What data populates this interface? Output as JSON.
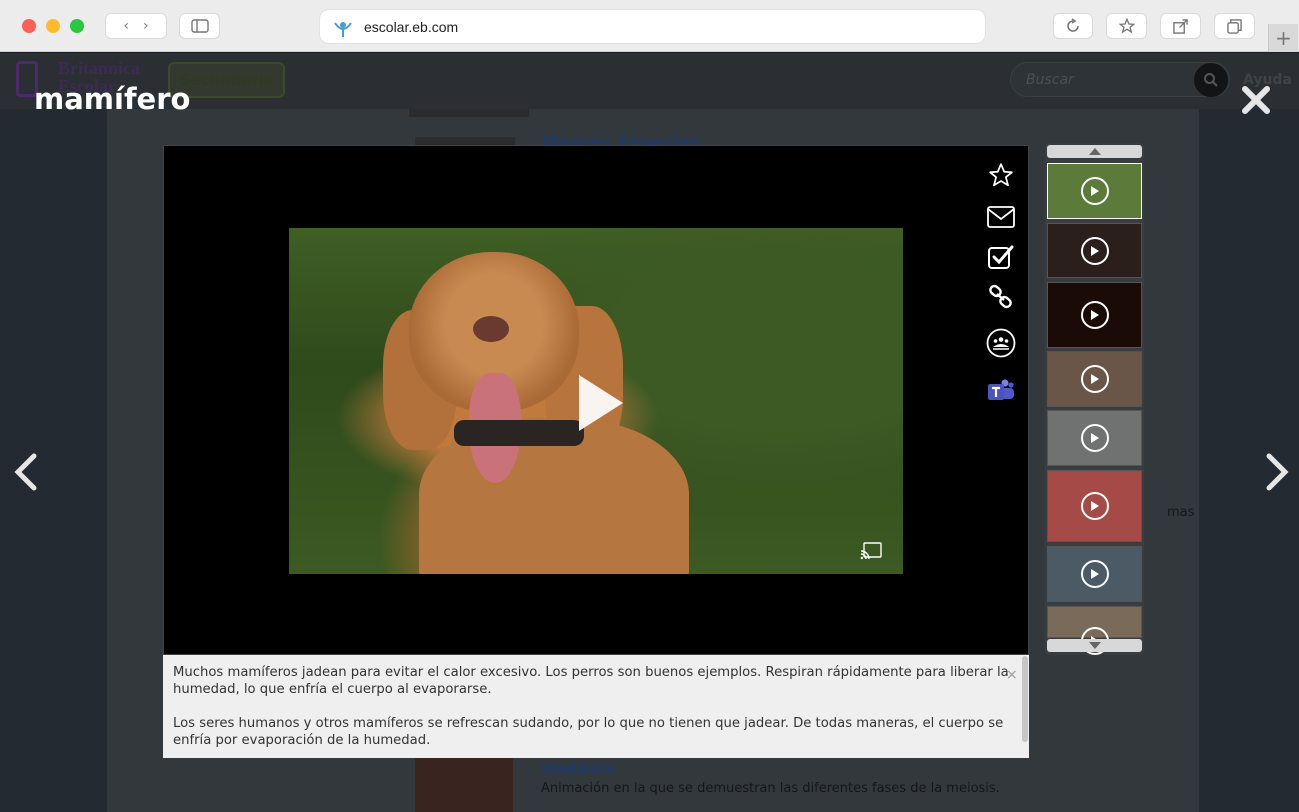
{
  "browser": {
    "url": "escolar.eb.com",
    "plus_label": "+"
  },
  "site": {
    "logo_line1": "Britannica",
    "logo_line2": "Escolar",
    "grade_label": "Secundaria",
    "search_placeholder": "Buscar",
    "help_label": "Ayuda"
  },
  "background": {
    "item_title": "meiosis",
    "item_desc": "Animación en la que se demuestran las diferentes fases de la meiosis.",
    "partial_link": "Madres Especies",
    "fragment_mas": "mas"
  },
  "modal": {
    "title": "mamífero",
    "caption_p1": "Muchos mamíferos jadean para evitar el calor excesivo. Los perros son buenos ejemplos. Respiran rápidamente para liberar la humedad, lo que enfría el cuerpo al evaporarse.",
    "caption_p2": "Los seres humanos y otros mamíferos se refrescan sudando, por lo que no tienen que jadear. De todas maneras, el cuerpo se enfría por evaporación de la humedad.",
    "caption_close": "×"
  },
  "toolbar": [
    {
      "name": "favorite-icon"
    },
    {
      "name": "email-icon"
    },
    {
      "name": "assignment-icon"
    },
    {
      "name": "link-icon"
    },
    {
      "name": "google-classroom-icon"
    },
    {
      "name": "microsoft-teams-icon"
    }
  ],
  "thumbnails": [
    {
      "name": "thumb-dog",
      "active": true,
      "bg": "#5c7a3a"
    },
    {
      "name": "thumb-city-night",
      "active": false,
      "bg": "#2a1f1a"
    },
    {
      "name": "thumb-fire-night",
      "active": false,
      "bg": "#1a0b06"
    },
    {
      "name": "thumb-portrait",
      "active": false,
      "bg": "#6a5648"
    },
    {
      "name": "thumb-ruins",
      "active": false,
      "bg": "#6f7270"
    },
    {
      "name": "thumb-red-animation",
      "active": false,
      "bg": "#a54a47"
    },
    {
      "name": "thumb-street",
      "active": false,
      "bg": "#4c5a66"
    },
    {
      "name": "thumb-partial",
      "active": false,
      "bg": "#7a6a5a"
    }
  ],
  "colors": {
    "overlay": "#1b1f24",
    "caption_bg": "#efefef",
    "teams": "#6264a7"
  }
}
